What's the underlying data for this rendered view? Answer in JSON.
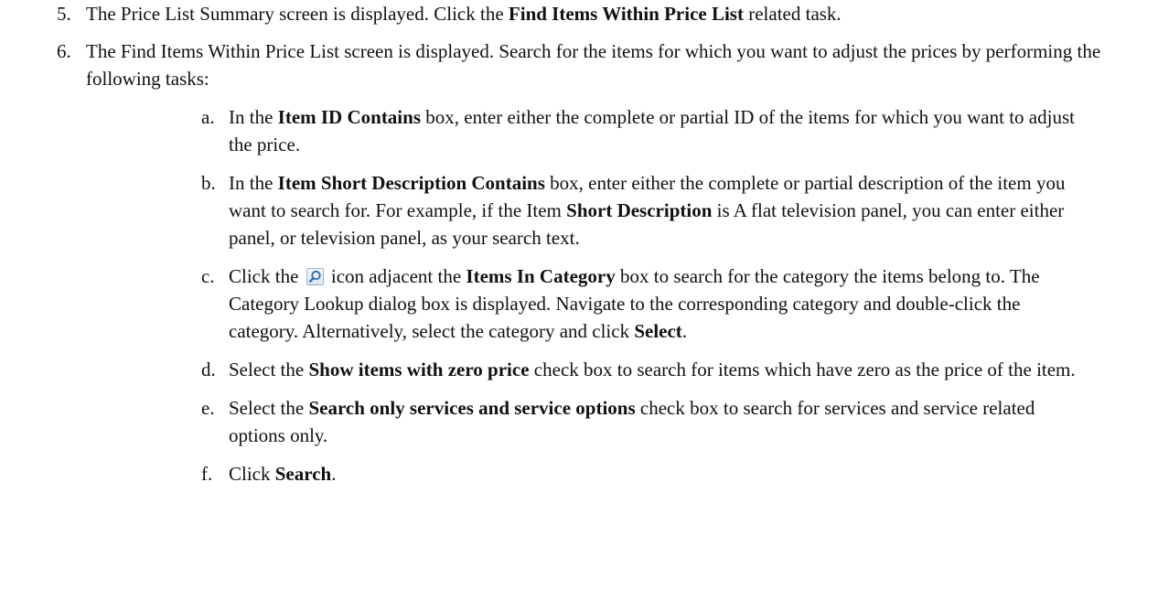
{
  "step5": {
    "num": "5.",
    "t1": "The Price List Summary screen is displayed. Click the ",
    "b1": "Find Items Within Price List",
    "t2": " related task."
  },
  "step6": {
    "num": "6.",
    "text": "The Find Items Within Price List screen is displayed. Search for the items for which you want to adjust the prices by performing the following tasks:",
    "a": {
      "letter": "a.",
      "t1": "In the ",
      "b1": "Item ID Contains",
      "t2": " box, enter either the complete or partial ID of the items for which you want to adjust the price."
    },
    "b": {
      "letter": "b.",
      "t1": "In the ",
      "b1": "Item Short Description Contains",
      "t2": " box, enter either the complete or partial description of the item you want to search for. For example, if the Item ",
      "b2": "Short Description",
      "t3": " is A flat television panel, you can enter either panel, or television panel, as your search text."
    },
    "c": {
      "letter": "c.",
      "t1": "Click the ",
      "icon": "search-icon",
      "t2": " icon adjacent the ",
      "b1": "Items In Category",
      "t3": " box to search for the category the items belong to. The Category Lookup dialog box is displayed. Navigate to the corresponding category and double-click the category. Alternatively, select the category and click ",
      "b2": "Select",
      "t4": "."
    },
    "d": {
      "letter": "d.",
      "t1": "Select the ",
      "b1": "Show items with zero price",
      "t2": " check box to search for items which have zero as the price of the item."
    },
    "e": {
      "letter": "e.",
      "t1": "Select the ",
      "b1": "Search only services and service options",
      "t2": " check box to search for services and service related options only."
    },
    "f": {
      "letter": "f.",
      "t1": "Click ",
      "b1": "Search",
      "t2": "."
    }
  }
}
